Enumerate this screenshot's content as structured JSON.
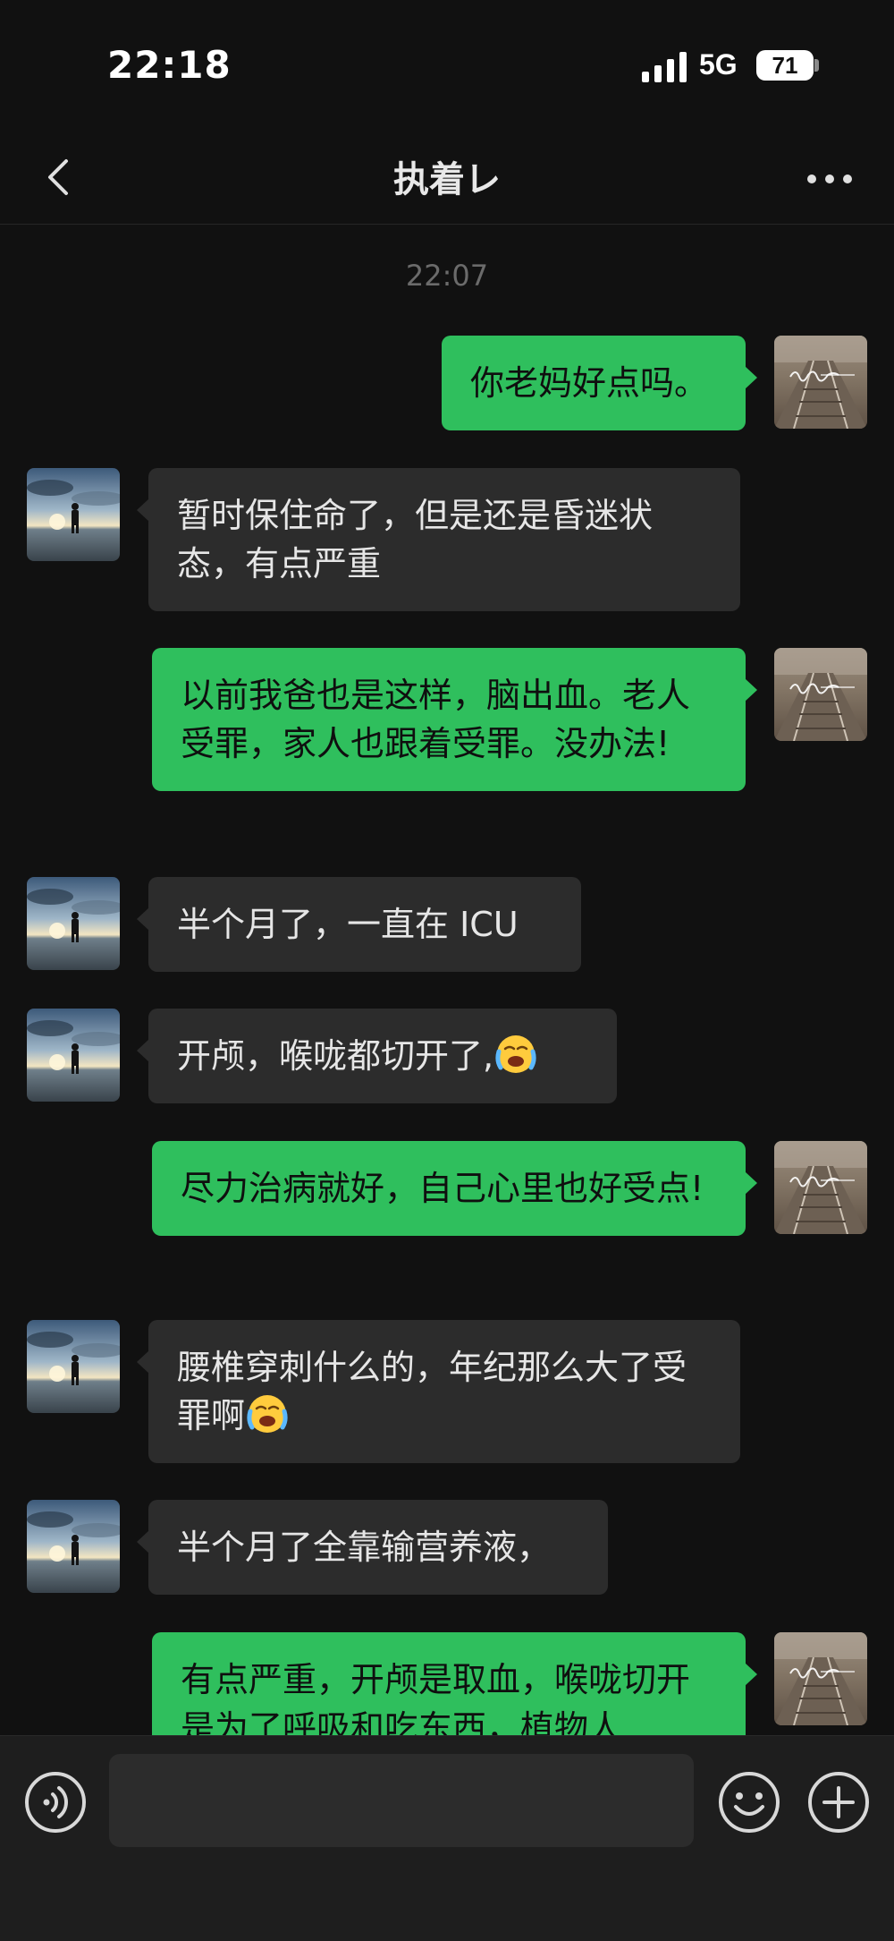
{
  "status_bar": {
    "time": "22:18",
    "network": "5G",
    "battery": "71"
  },
  "nav": {
    "title": "执着レ",
    "back_icon": "chevron-left-icon",
    "more_icon": "more-dots-icon"
  },
  "chat": {
    "timestamp": "22:07",
    "messages": [
      {
        "side": "out",
        "text": "你老妈好点吗。"
      },
      {
        "side": "in",
        "text": "暂时保住命了，但是还是昏迷状态，有点严重"
      },
      {
        "side": "out",
        "text": "以前我爸也是这样，脑出血。老人受罪，家人也跟着受罪。没办法!"
      },
      {
        "side": "in",
        "text": "半个月了，一直在 ICU"
      },
      {
        "side": "in",
        "text": "开颅，喉咙都切开了,",
        "emoji": "loudly-crying-face"
      },
      {
        "side": "out",
        "text": "尽力治病就好，自己心里也好受点!"
      },
      {
        "side": "in",
        "text": "腰椎穿刺什么的，年纪那么大了受罪啊",
        "emoji": "loudly-crying-face"
      },
      {
        "side": "in",
        "text": "半个月了全靠输营养液，"
      },
      {
        "side": "out",
        "text": "有点严重，开颅是取血，喉咙切开是为了呼吸和吃东西，植物人"
      }
    ]
  },
  "input_bar": {
    "placeholder": "",
    "voice_icon": "voice-icon",
    "emoji_icon": "smiley-icon",
    "plus_icon": "plus-icon"
  },
  "colors": {
    "background": "#111111",
    "outgoing_bubble": "#2fbf5d",
    "incoming_bubble": "#2c2c2c"
  }
}
